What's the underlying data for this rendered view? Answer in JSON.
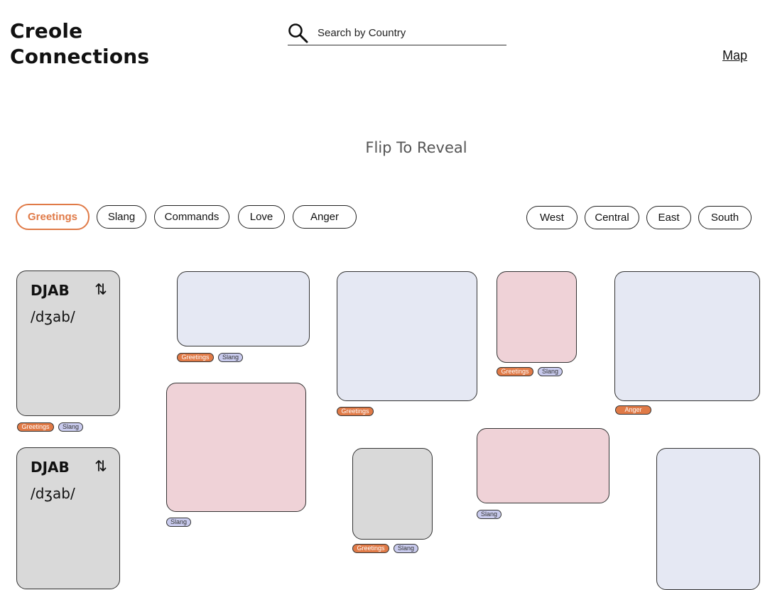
{
  "header": {
    "logo": "Creole\nConnections",
    "search_placeholder": "Search by Country",
    "map_link": "Map"
  },
  "subtitle": "Flip To Reveal",
  "category_filters": [
    "Greetings",
    "Slang",
    "Commands",
    "Love",
    "Anger"
  ],
  "active_category": "Greetings",
  "region_filters": [
    "West",
    "Central",
    "East",
    "South"
  ],
  "cards": [
    {
      "word": "DJAB",
      "ipa": "/dʒab/",
      "tags": [
        "Greetings",
        "Slang"
      ]
    },
    {
      "word": "DJAB",
      "ipa": "/dʒab/",
      "tags": []
    }
  ],
  "card_tags": {
    "greetings": "Greetings",
    "slang": "Slang",
    "anger": "Anger"
  },
  "colors": {
    "accent": "#e07a47",
    "card_gray": "#d9d9d9",
    "card_blue": "#e5e8f3",
    "card_pink": "#efd2d7",
    "tag_slang": "#c9cbee"
  },
  "icons": {
    "search": "search-icon",
    "flip": "flip-arrows-icon"
  }
}
